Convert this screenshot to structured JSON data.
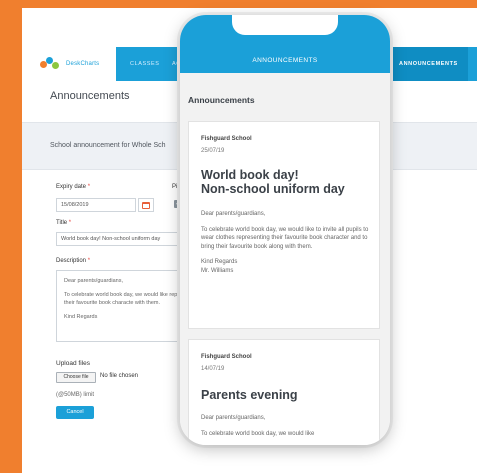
{
  "desktop": {
    "logo_text": "DeskCharts",
    "nav": [
      {
        "label": "CLASSES"
      },
      {
        "label": "ACTIVI"
      },
      {
        "label": "ANNOUNCEMENTS"
      }
    ],
    "page_title": "Announcements",
    "announcement_header": "School announcement for Whole Sch",
    "form": {
      "expiry_label": "Expiry date",
      "expiry_value": "15/08/2019",
      "pinned_label": "Pinned",
      "title_label": "Title",
      "title_value": "World book day! Non-school uniform day",
      "description_label": "Description",
      "description_lines": [
        "Dear parents/guardians,",
        "To celebrate world book day, we would like representing their favourite book characte with them.",
        "Kind Regards"
      ],
      "upload_label": "Upload files",
      "choose_file": "Choose file",
      "file_status": "No file chosen",
      "limit": "(@50MB) limit",
      "cancel": "Cancel",
      "required_mark": "*"
    },
    "colors": {
      "brand_blue": "#1ba0d8",
      "background": "#f07f2e",
      "required": "#e8403a"
    }
  },
  "phone": {
    "tab": "ANNOUNCEMENTS",
    "heading": "Announcements",
    "cards": [
      {
        "school": "Fishguard School",
        "date": "25/07/19",
        "title_line1": "World book day!",
        "title_line2": "Non-school uniform day",
        "greeting": "Dear parents/guardians,",
        "text": "To celebrate world book day, we would like to invite all pupils to wear clothes representing their favourite book character and to bring their favourite book along with them.",
        "signoff1": "Kind Regards",
        "signoff2": "Mr. Williams"
      },
      {
        "school": "Fishguard School",
        "date": "14/07/19",
        "title": "Parents evening",
        "greeting": "Dear parents/guardians,",
        "text": "To celebrate world book day, we would like"
      }
    ]
  }
}
